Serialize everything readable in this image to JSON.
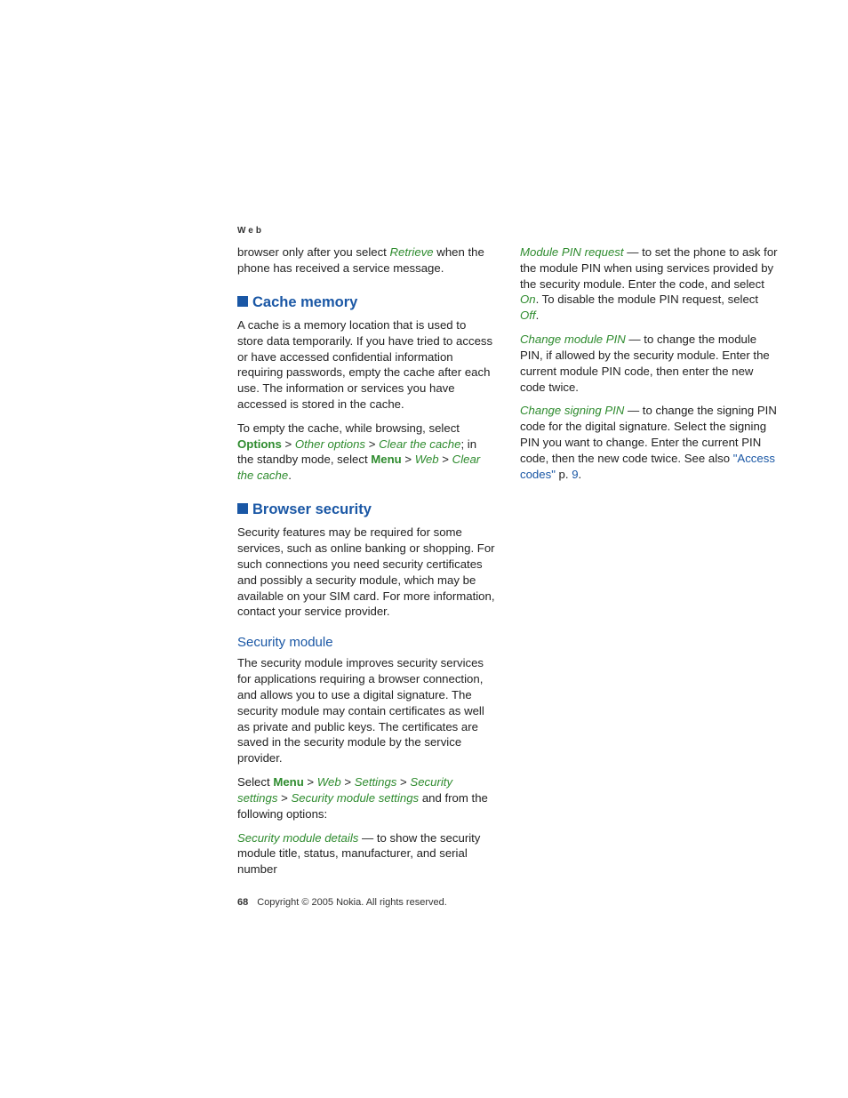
{
  "header": "Web",
  "intro": {
    "pre": "browser only after you select ",
    "retrieve": "Retrieve",
    "post": " when the phone has received a service message."
  },
  "cache": {
    "heading": "Cache memory",
    "p1": "A cache is a memory location that is used to store data temporarily. If you have tried to access or have accessed confidential information requiring passwords, empty the cache after each use. The information or services you have accessed is stored in the cache.",
    "p2a": "To empty the cache, while browsing, select ",
    "options": "Options",
    "gt": " > ",
    "other": "Other options",
    "clear": "Clear the cache",
    "p2b": "; in the standby mode, select ",
    "menu": "Menu",
    "web": "Web",
    "period": "."
  },
  "browser": {
    "heading": "Browser security",
    "p1": "Security features may be required for some services, such as online banking or shopping. For such connections you need security certificates and possibly a security module, which may be available on your SIM card. For more information, contact your service provider."
  },
  "secmod": {
    "heading": "Security module",
    "p1": "The security module improves security services for applications requiring a browser connection, and allows you to use a digital signature. The security module may contain certificates as well as private and public keys. The certificates are saved in the security module by the service provider.",
    "p2a": "Select ",
    "menu": "Menu",
    "web": "Web",
    "settings": "Settings",
    "secset": "Security settings",
    "secmodset": "Security module settings",
    "p2b": " and from the following options:",
    "opt1_t": "Security module details",
    "opt1_b": " — to show the security module title, status, manufacturer, and serial number",
    "opt2_t": "Module PIN request",
    "opt2_b1": " — to set the phone to ask for the module PIN when using services provided by the security module. Enter the code, and select ",
    "on": "On",
    "opt2_b2": ". To disable the module PIN request, select ",
    "off": "Off",
    "opt3_t": "Change module PIN",
    "opt3_b": " — to change the module PIN, if allowed by the security module. Enter the current module PIN code, then enter the new code twice.",
    "opt4_t": "Change signing PIN",
    "opt4_b1": " — to change the signing PIN code for the digital signature. Select the signing PIN you want to change. Enter the current PIN code, then the new code twice. See also ",
    "access": "\"Access codes\"",
    "pdot": " p. ",
    "pnum": "9",
    "period": "."
  },
  "footer": {
    "page": "68",
    "copy": "Copyright © 2005 Nokia. All rights reserved."
  }
}
